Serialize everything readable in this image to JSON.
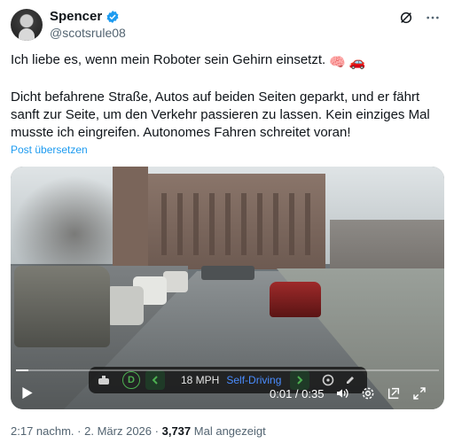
{
  "author": {
    "display_name": "Spencer",
    "handle": "@scotsrule08",
    "verified": true
  },
  "post": {
    "line1": "Ich liebe es, wenn mein Roboter sein Gehirn einsetzt.",
    "emoji": [
      "🧠",
      "🚗"
    ],
    "paragraph2": "Dicht befahrene Straße, Autos auf beiden Seiten geparkt, und er fährt sanft zur Seite, um den Verkehr passieren zu lassen. Kein einziges Mal musste ich eingreifen. Autonomes Fahren schreitet voran!",
    "translate_link": "Post übersetzen"
  },
  "video": {
    "hud": {
      "gear": "D",
      "speed": "18 MPH",
      "mode": "Self-Driving"
    },
    "time": "0:01 / 0:35",
    "progress_fraction": 0.03,
    "icons": [
      "play-icon",
      "volume-icon",
      "settings-icon",
      "pip-icon",
      "fullscreen-icon"
    ]
  },
  "meta": {
    "time": "2:17 nachm.",
    "separator": "·",
    "date": "2. März 2026",
    "views": "3,737",
    "views_label": "Mal angezeigt"
  },
  "colors": {
    "link": "#1d9bf0",
    "muted": "#536471",
    "verified": "#1d9bf0",
    "hud_green": "#4caf50",
    "hud_blue": "#4a8cff"
  }
}
